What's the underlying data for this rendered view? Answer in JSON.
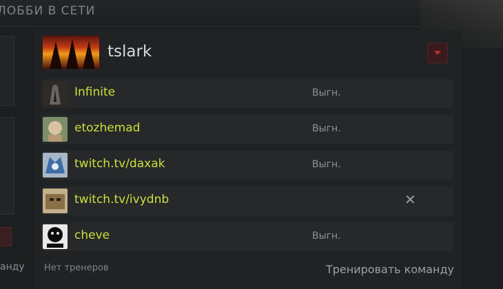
{
  "section_title": "ЛОББИ В СЕТИ",
  "bottom_left_text": "анду",
  "team": {
    "name": "tslark",
    "logo_icon": "team-logo-icon"
  },
  "players": [
    {
      "name": "Infinite",
      "status": "Выгн.",
      "avatar_icon": "player-avatar-icon",
      "avatar_colors": [
        "#2e2a26",
        "#6a6460"
      ]
    },
    {
      "name": "etozhemad",
      "status": "Выгн.",
      "avatar_icon": "player-avatar-icon",
      "avatar_colors": [
        "#7d8e6a",
        "#d7c3a1"
      ]
    },
    {
      "name": "twitch.tv/daxak",
      "status": "Выгн.",
      "avatar_icon": "player-avatar-icon",
      "avatar_colors": [
        "#3d6ea8",
        "#a9b8c7"
      ]
    },
    {
      "name": "twitch.tv/ivydnb",
      "status": "",
      "avatar_icon": "player-avatar-icon",
      "avatar_colors": [
        "#8a6f48",
        "#c2b08a"
      ]
    },
    {
      "name": "cheve",
      "status": "Выгн.",
      "avatar_icon": "player-avatar-icon",
      "avatar_colors": [
        "#0c0c0c",
        "#e9e9e9"
      ]
    }
  ],
  "footer": {
    "coaches_text": "Нет тренеров",
    "train_team_label": "Тренировать команду"
  },
  "colors": {
    "player_name": "#c7e23b",
    "accent_red": "#c02a2e"
  }
}
